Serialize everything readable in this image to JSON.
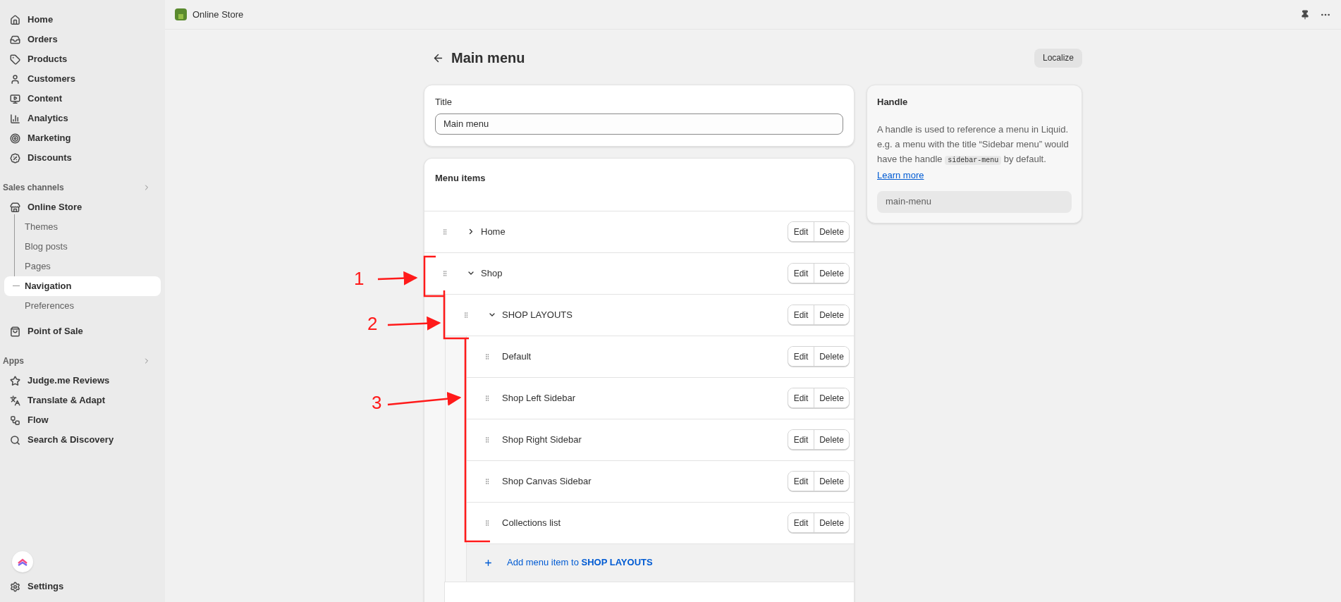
{
  "sidebar": {
    "nav": [
      {
        "label": "Home",
        "selected": false
      },
      {
        "label": "Orders",
        "selected": false
      },
      {
        "label": "Products",
        "selected": false
      },
      {
        "label": "Customers",
        "selected": false
      },
      {
        "label": "Content",
        "selected": false
      },
      {
        "label": "Analytics",
        "selected": false
      },
      {
        "label": "Marketing",
        "selected": false
      },
      {
        "label": "Discounts",
        "selected": false
      }
    ],
    "sections": [
      {
        "title": "Sales channels",
        "items": [
          {
            "label": "Online Store",
            "selected": false,
            "children": [
              {
                "label": "Themes",
                "selected": false
              },
              {
                "label": "Blog posts",
                "selected": false
              },
              {
                "label": "Pages",
                "selected": false
              },
              {
                "label": "Navigation",
                "selected": true
              },
              {
                "label": "Preferences",
                "selected": false
              }
            ]
          },
          {
            "label": "Point of Sale",
            "selected": false
          }
        ]
      },
      {
        "title": "Apps",
        "items": [
          {
            "label": "Judge.me Reviews",
            "selected": false
          },
          {
            "label": "Translate & Adapt",
            "selected": false
          },
          {
            "label": "Flow",
            "selected": false
          },
          {
            "label": "Search & Discovery",
            "selected": false
          }
        ]
      }
    ],
    "footer": {
      "label": "Settings"
    }
  },
  "topbar": {
    "title": "Online Store"
  },
  "page": {
    "title": "Main menu",
    "action": "Localize"
  },
  "title_card": {
    "label": "Title",
    "value": "Main menu"
  },
  "menu_card": {
    "title": "Menu items",
    "items": [
      {
        "label": "Home",
        "expanded": false,
        "actions": [
          "Edit",
          "Delete"
        ]
      },
      {
        "label": "Shop",
        "expanded": true,
        "actions": [
          "Edit",
          "Delete"
        ],
        "children": [
          {
            "label": "SHOP LAYOUTS",
            "expanded": true,
            "actions": [
              "Edit",
              "Delete"
            ],
            "add_label": "Add menu item to **SHOP LAYOUTS**",
            "children": [
              {
                "label": "Default",
                "actions": [
                  "Edit",
                  "Delete"
                ]
              },
              {
                "label": "Shop Left Sidebar",
                "actions": [
                  "Edit",
                  "Delete"
                ]
              },
              {
                "label": "Shop Right Sidebar",
                "actions": [
                  "Edit",
                  "Delete"
                ]
              },
              {
                "label": "Shop Canvas Sidebar",
                "actions": [
                  "Edit",
                  "Delete"
                ]
              },
              {
                "label": "Collections list",
                "actions": [
                  "Edit",
                  "Delete"
                ]
              }
            ]
          }
        ]
      }
    ]
  },
  "handle_card": {
    "title": "Handle",
    "description_before": "A handle is used to reference a menu in Liquid. e.g. a menu with the title “Sidebar menu” would have the handle",
    "code": "sidebar-menu",
    "description_after": "by default.",
    "link": "Learn more",
    "value": "main-menu"
  },
  "annotations": [
    {
      "label": "1"
    },
    {
      "label": "2"
    },
    {
      "label": "3"
    }
  ]
}
